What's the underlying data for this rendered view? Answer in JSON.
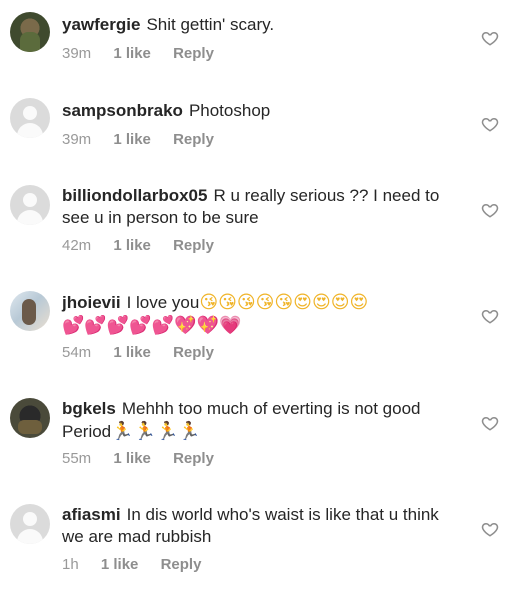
{
  "comments": [
    {
      "username": "yawfergie",
      "text": "Shit gettin' scary.",
      "time": "39m",
      "likes": "1 like",
      "reply": "Reply",
      "avatar": "photo"
    },
    {
      "username": "sampsonbrako",
      "text": "Photoshop",
      "time": "39m",
      "likes": "1 like",
      "reply": "Reply",
      "avatar": "default"
    },
    {
      "username": "billiondollarbox05",
      "text": "R u really serious ?? I need to see u in person to be sure",
      "time": "42m",
      "likes": "1 like",
      "reply": "Reply",
      "avatar": "default"
    },
    {
      "username": "jhoievii",
      "text": "I love you",
      "emojis": [
        "😘",
        "😘",
        "😘",
        "😘",
        "😘",
        "😍",
        "😍",
        "😍",
        "😍",
        "💕",
        "💕",
        "💕",
        "💕",
        "💕",
        "💖",
        "💖",
        "💗"
      ],
      "time": "54m",
      "likes": "1 like",
      "reply": "Reply",
      "avatar": "photo"
    },
    {
      "username": "bgkels",
      "text": "Mehhh too much of everting is not good Period",
      "emojis": [
        "🏃",
        "🏃",
        "🏃",
        "🏃"
      ],
      "time": "55m",
      "likes": "1 like",
      "reply": "Reply",
      "avatar": "photo"
    },
    {
      "username": "afiasmi",
      "text": "In dis world who's waist is like that u think we are mad rubbish",
      "time": "1h",
      "likes": "1 like",
      "reply": "Reply",
      "avatar": "default"
    }
  ],
  "icons": {
    "like": "heart-outline-icon"
  },
  "colors": {
    "text": "#262626",
    "meta": "#999999"
  }
}
